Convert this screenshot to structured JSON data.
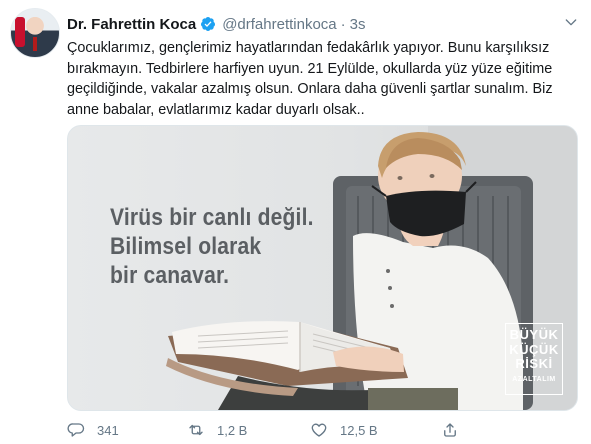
{
  "tweet": {
    "display_name": "Dr. Fahrettin Koca",
    "handle": "@drfahrettinkoca",
    "separator": "·",
    "time": "3s",
    "text": "Çocuklarımız, gençlerimiz hayatlarından fedakârlık yapıyor. Bunu karşılıksız\nbırakmayın. Tedbirlere harfiyen uyun. 21 Eylülde, okullarda yüz yüze eğitime\ngeçildiğinde, vakalar azalmış olsun. Onlara daha güvenli şartlar sunalım. Biz\nanne babalar, evlatlarımız kadar duyarlı olsak..",
    "media": {
      "overlay_text": "Virüs bir canlı değil.\nBilimsel olarak\nbir canavar.",
      "badge": {
        "line1": "BÜYÜK",
        "line2": "KÜÇÜK",
        "line3": "RİSKİ",
        "line4": "AZALTALIM"
      }
    },
    "actions": {
      "replies": "341",
      "retweets": "1,2 B",
      "likes": "12,5 B"
    }
  },
  "colors": {
    "text": "#14171a",
    "secondary": "#657786",
    "verified": "#1da1f2",
    "background": "#ffffff"
  }
}
